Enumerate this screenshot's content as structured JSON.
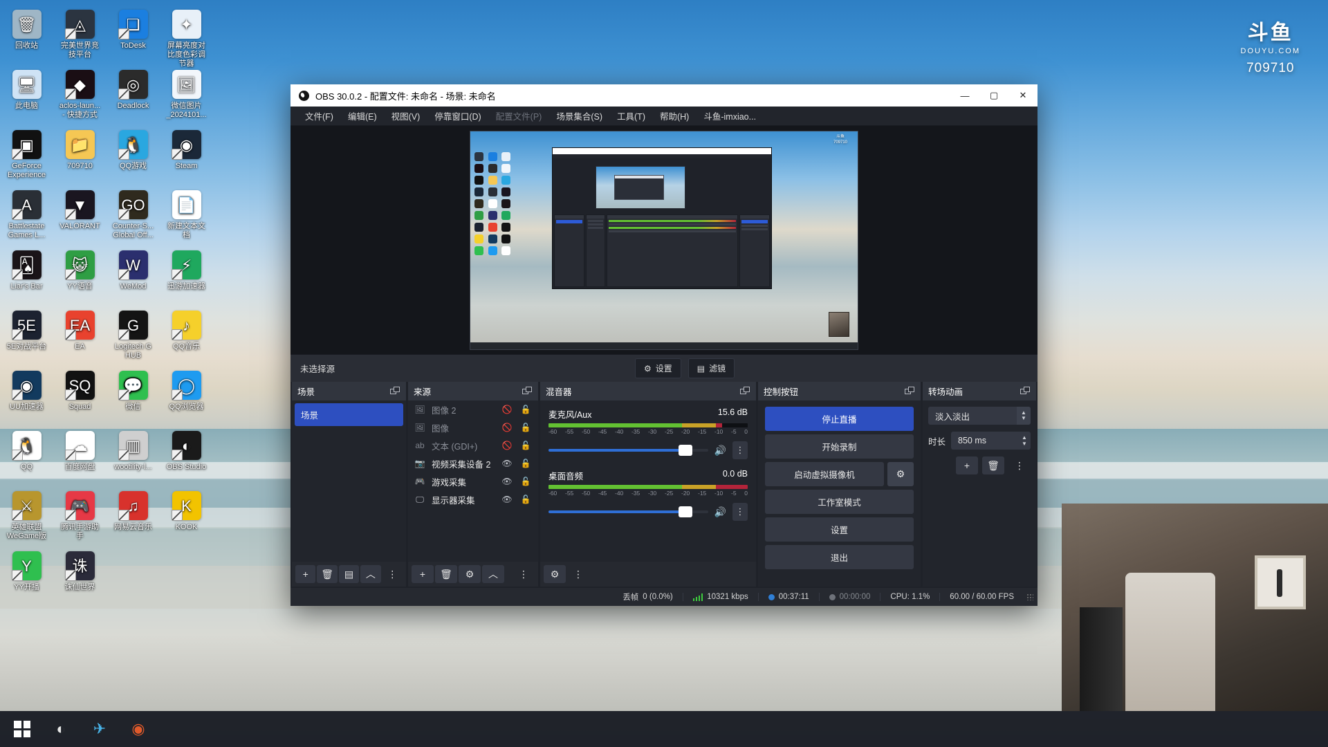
{
  "desktop": {
    "icons": [
      {
        "label": "回收站",
        "glyph": "🗑",
        "bg": "#9fb6c6",
        "shortcut": false
      },
      {
        "label": "完美世界竞技平台",
        "glyph": "◬",
        "bg": "#2b3440",
        "shortcut": true
      },
      {
        "label": "ToDesk",
        "glyph": "❏",
        "bg": "#1b7fe0",
        "shortcut": true
      },
      {
        "label": "屏幕亮度对比度色彩调节器",
        "glyph": "✦",
        "bg": "#e8f0f8",
        "shortcut": false
      },
      {
        "label": "此电脑",
        "glyph": "🖥",
        "bg": "#cfe3f5",
        "shortcut": false
      },
      {
        "label": "aclos-laun... - 快捷方式",
        "glyph": "◆",
        "bg": "#1a0e14",
        "shortcut": true
      },
      {
        "label": "Deadlock",
        "glyph": "◎",
        "bg": "#2b2b2b",
        "shortcut": true
      },
      {
        "label": "微信图片_2024101...",
        "glyph": "🖼",
        "bg": "#f2f6fb",
        "shortcut": false
      },
      {
        "label": "GeForce Experience",
        "glyph": "▣",
        "bg": "#111111",
        "shortcut": true
      },
      {
        "label": "709710",
        "glyph": "📁",
        "bg": "#f5c754",
        "shortcut": false
      },
      {
        "label": "QQ游戏",
        "glyph": "🐧",
        "bg": "#2aa7e0",
        "shortcut": true
      },
      {
        "label": "Steam",
        "glyph": "◉",
        "bg": "#1b2838",
        "shortcut": true
      },
      {
        "label": "Battlestate Games L...",
        "glyph": "A",
        "bg": "#2a2f36",
        "shortcut": true
      },
      {
        "label": "VALORANT",
        "glyph": "▼",
        "bg": "#1a1620",
        "shortcut": true
      },
      {
        "label": "Counter-S... Global Off...",
        "glyph": "GO",
        "bg": "#2f2a1e",
        "shortcut": true
      },
      {
        "label": "新建文本文档",
        "glyph": "📄",
        "bg": "#ffffff",
        "shortcut": false
      },
      {
        "label": "Liar's Bar",
        "glyph": "🂡",
        "bg": "#1a1418",
        "shortcut": true
      },
      {
        "label": "YY语音",
        "glyph": "😺",
        "bg": "#2f9e44",
        "shortcut": true
      },
      {
        "label": "WeMod",
        "glyph": "W",
        "bg": "#2b2f6e",
        "shortcut": true
      },
      {
        "label": "迅游加速器",
        "glyph": "⚡",
        "bg": "#1fa85e",
        "shortcut": true
      },
      {
        "label": "5E对战平台",
        "glyph": "5E",
        "bg": "#1c2230",
        "shortcut": true
      },
      {
        "label": "EA",
        "glyph": "EA",
        "bg": "#e8422e",
        "shortcut": true
      },
      {
        "label": "Logitech G HUB",
        "glyph": "G",
        "bg": "#141414",
        "shortcut": true
      },
      {
        "label": "QQ音乐",
        "glyph": "♪",
        "bg": "#f5d02b",
        "shortcut": true
      },
      {
        "label": "UU加速器",
        "glyph": "◉",
        "bg": "#123a5e",
        "shortcut": true
      },
      {
        "label": "Squad",
        "glyph": "SQ",
        "bg": "#121212",
        "shortcut": true
      },
      {
        "label": "微信",
        "glyph": "💬",
        "bg": "#2fbf4f",
        "shortcut": true
      },
      {
        "label": "QQ浏览器",
        "glyph": "◯",
        "bg": "#1e9bf0",
        "shortcut": true
      },
      {
        "label": "QQ",
        "glyph": "🐧",
        "bg": "#ffffff",
        "shortcut": true
      },
      {
        "label": "百度网盘",
        "glyph": "☁",
        "bg": "#ffffff",
        "shortcut": true
      },
      {
        "label": "wootility-l...",
        "glyph": "▥",
        "bg": "#cfcfcf",
        "shortcut": true
      },
      {
        "label": "OBS Studio",
        "glyph": "◐",
        "bg": "#1a1a1a",
        "shortcut": true
      },
      {
        "label": "英雄联盟 WeGame版",
        "glyph": "⚔",
        "bg": "#b8962e",
        "shortcut": true
      },
      {
        "label": "腾讯手游助手",
        "glyph": "🎮",
        "bg": "#e63946",
        "shortcut": true
      },
      {
        "label": "网易云音乐",
        "glyph": "♫",
        "bg": "#d8322c",
        "shortcut": true
      },
      {
        "label": "KOOK",
        "glyph": "K",
        "bg": "#f2c300",
        "shortcut": true
      },
      {
        "label": "YY开播",
        "glyph": "Y",
        "bg": "#2fbf4f",
        "shortcut": true
      },
      {
        "label": "诛仙世界",
        "glyph": "诛",
        "bg": "#2b2b3a",
        "shortcut": true
      }
    ],
    "watermark": {
      "logo": "斗鱼",
      "sub": "DOUYU.COM",
      "room": "709710"
    }
  },
  "taskbar": {
    "items": [
      {
        "name": "start-button",
        "glyph": "⊞"
      },
      {
        "name": "obs-taskbar-icon",
        "glyph": "◐"
      },
      {
        "name": "browser-taskbar-icon",
        "glyph": "✈"
      },
      {
        "name": "media-taskbar-icon",
        "glyph": "◉"
      }
    ]
  },
  "obs": {
    "title": "OBS 30.0.2 - 配置文件: 未命名 - 场景: 未命名",
    "window_controls": {
      "minimize": "—",
      "maximize": "▢",
      "close": "✕"
    },
    "menu": [
      {
        "label": "文件(F)",
        "dim": false
      },
      {
        "label": "编辑(E)",
        "dim": false
      },
      {
        "label": "视图(V)",
        "dim": false
      },
      {
        "label": "停靠窗口(D)",
        "dim": false
      },
      {
        "label": "配置文件(P)",
        "dim": true
      },
      {
        "label": "场景集合(S)",
        "dim": false
      },
      {
        "label": "工具(T)",
        "dim": false
      },
      {
        "label": "帮助(H)",
        "dim": false
      },
      {
        "label": "斗鱼-imxiao...",
        "dim": false
      }
    ],
    "source_toolbar": {
      "no_source_label": "未选择源",
      "settings_label": "设置",
      "settings_icon": "⚙",
      "filters_label": "滤镜",
      "filters_icon": "▤"
    },
    "scenes_dock": {
      "title": "场景",
      "items": [
        {
          "label": "场景",
          "selected": true
        }
      ],
      "footer": [
        {
          "name": "add-scene-button",
          "glyph": "+"
        },
        {
          "name": "remove-scene-button",
          "glyph": "🗑"
        },
        {
          "name": "scene-filters-button",
          "glyph": "▤"
        },
        {
          "name": "move-scene-up-button",
          "glyph": "︿"
        },
        {
          "name": "scene-options-button",
          "glyph": "⋮"
        }
      ]
    },
    "sources_dock": {
      "title": "来源",
      "items": [
        {
          "name": "图像 2",
          "icon": "image-icon",
          "icon_glyph": "🖼",
          "visible": false,
          "locked": false
        },
        {
          "name": "图像",
          "icon": "image-icon",
          "icon_glyph": "🖼",
          "visible": false,
          "locked": false
        },
        {
          "name": "文本 (GDI+)",
          "icon": "text-icon",
          "icon_glyph": "ab",
          "visible": false,
          "locked": false
        },
        {
          "name": "视频采集设备 2",
          "icon": "camera-icon",
          "icon_glyph": "📷",
          "visible": true,
          "locked": false
        },
        {
          "name": "游戏采集",
          "icon": "gamepad-icon",
          "icon_glyph": "🎮",
          "visible": true,
          "locked": false
        },
        {
          "name": "显示器采集",
          "icon": "monitor-icon",
          "icon_glyph": "🖵",
          "visible": true,
          "locked": false
        }
      ],
      "footer": [
        {
          "name": "add-source-button",
          "glyph": "+"
        },
        {
          "name": "remove-source-button",
          "glyph": "🗑"
        },
        {
          "name": "source-properties-button",
          "glyph": "⚙"
        },
        {
          "name": "move-source-up-button",
          "glyph": "︿"
        },
        {
          "name": "source-options-button",
          "glyph": "⋮"
        }
      ]
    },
    "mixer_dock": {
      "title": "混音器",
      "scale_ticks": [
        "-60",
        "-55",
        "-50",
        "-45",
        "-40",
        "-35",
        "-30",
        "-25",
        "-20",
        "-15",
        "-10",
        "-5",
        "0"
      ],
      "channels": [
        {
          "name": "麦克风/Aux",
          "db": "15.6 dB",
          "level_percent": 87,
          "volume_percent": 86,
          "muted": false,
          "speaker_glyph": "🔊"
        },
        {
          "name": "桌面音频",
          "db": "0.0 dB",
          "level_percent": 100,
          "volume_percent": 86,
          "muted": false,
          "speaker_glyph": "🔊"
        }
      ],
      "footer": [
        {
          "name": "mixer-audio-settings-button",
          "glyph": "⚙"
        },
        {
          "name": "mixer-options-button",
          "glyph": "⋮"
        }
      ]
    },
    "controls_dock": {
      "title": "控制按钮",
      "buttons": [
        {
          "label": "停止直播",
          "primary": true,
          "name": "stop-stream-button"
        },
        {
          "label": "开始录制",
          "primary": false,
          "name": "start-recording-button"
        },
        {
          "label": "启动虚拟摄像机",
          "primary": false,
          "name": "start-virtual-camera-button",
          "gear": true
        },
        {
          "label": "工作室模式",
          "primary": false,
          "name": "studio-mode-button"
        },
        {
          "label": "设置",
          "primary": false,
          "name": "settings-button"
        },
        {
          "label": "退出",
          "primary": false,
          "name": "exit-button"
        }
      ],
      "virtual_cam_gear_glyph": "⚙"
    },
    "transitions_dock": {
      "title": "转场动画",
      "selected_transition": "淡入淡出",
      "duration_label": "时长",
      "duration_value": "850 ms",
      "buttons": [
        {
          "name": "add-transition-button",
          "glyph": "+"
        },
        {
          "name": "remove-transition-button",
          "glyph": "🗑"
        },
        {
          "name": "transition-options-button",
          "glyph": "⋮"
        }
      ]
    },
    "status_bar": {
      "dropped_frames_label": "丢帧",
      "dropped_frames_value": "0 (0.0%)",
      "bitrate": "10321 kbps",
      "stream_time": "00:37:11",
      "record_time": "00:00:00",
      "cpu": "CPU: 1.1%",
      "fps": "60.00 / 60.00 FPS"
    }
  },
  "colors": {
    "accent_blue": "#2d4fc0",
    "panel_bg": "#22252c",
    "header_bg": "#31353e",
    "window_bg": "#1f2229",
    "meter_green": "#63c132",
    "meter_yellow": "#c9a227",
    "meter_red": "#b3243a",
    "title_bar": "#ffffff"
  }
}
